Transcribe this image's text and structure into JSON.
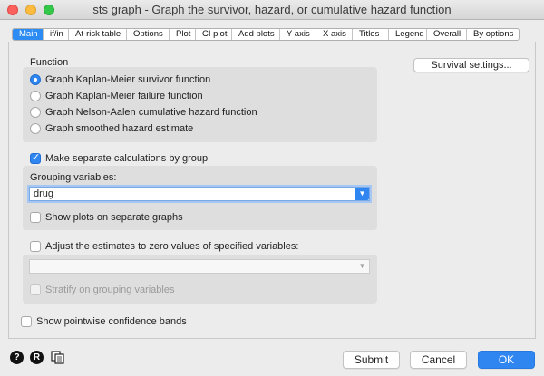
{
  "window": {
    "title": "sts graph - Graph the survivor, hazard, or cumulative hazard function"
  },
  "tabs": [
    {
      "label": "Main",
      "active": true
    },
    {
      "label": "if/in"
    },
    {
      "label": "At-risk table"
    },
    {
      "label": "Options"
    },
    {
      "label": "Plot"
    },
    {
      "label": "CI plot"
    },
    {
      "label": "Add plots"
    },
    {
      "label": "Y axis"
    },
    {
      "label": "X axis"
    },
    {
      "label": "Titles"
    },
    {
      "label": "Legend"
    },
    {
      "label": "Overall"
    },
    {
      "label": "By options"
    }
  ],
  "function": {
    "label": "Function",
    "options": [
      {
        "label": "Graph Kaplan-Meier survivor function",
        "selected": true
      },
      {
        "label": "Graph Kaplan-Meier failure function",
        "selected": false
      },
      {
        "label": "Graph Nelson-Aalen cumulative hazard function",
        "selected": false
      },
      {
        "label": "Graph smoothed hazard estimate",
        "selected": false
      }
    ]
  },
  "survival_settings_label": "Survival settings...",
  "separate": {
    "label": "Make separate calculations by group",
    "checked": true
  },
  "grouping": {
    "label": "Grouping variables:",
    "value": "drug",
    "separate_graphs": {
      "label": "Show plots on separate graphs",
      "checked": false
    }
  },
  "adjust": {
    "label": "Adjust the estimates to zero values of specified variables:",
    "checked": false,
    "value": "",
    "stratify": {
      "label": "Stratify on grouping variables",
      "checked": false,
      "disabled": true
    }
  },
  "confidence": {
    "label": "Show pointwise confidence bands",
    "checked": false
  },
  "footer": {
    "help_icon": "help-icon",
    "r_icon": "r-icon",
    "copy_icon": "copy-icon",
    "submit": "Submit",
    "cancel": "Cancel",
    "ok": "OK"
  },
  "colors": {
    "accent": "#2f86f0",
    "tab_active": "#2c8cf4"
  }
}
